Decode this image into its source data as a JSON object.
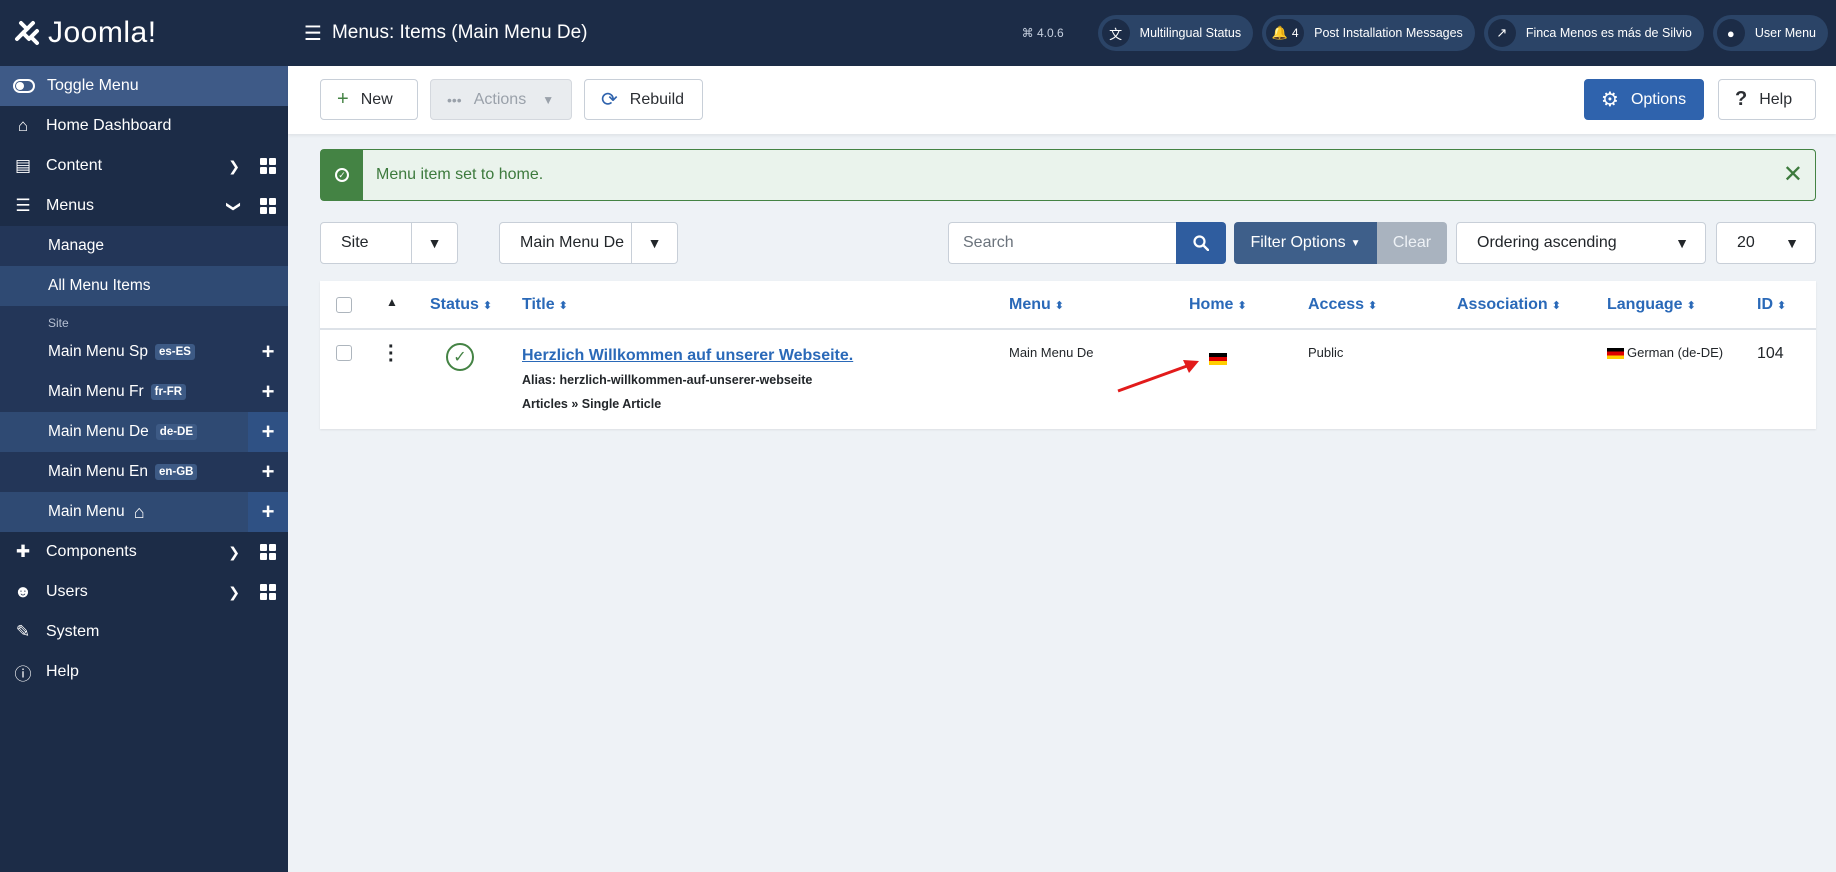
{
  "brand": {
    "name": "Joomla!"
  },
  "sidebar": {
    "toggle_label": "Toggle Menu",
    "home": "Home Dashboard",
    "content": "Content",
    "menus": "Menus",
    "menus_sub": {
      "manage": "Manage",
      "all_items": "All Menu Items",
      "site_label": "Site",
      "items": [
        {
          "label": "Main Menu Sp",
          "badge": "es-ES"
        },
        {
          "label": "Main Menu Fr",
          "badge": "fr-FR"
        },
        {
          "label": "Main Menu De",
          "badge": "de-DE"
        },
        {
          "label": "Main Menu En",
          "badge": "en-GB"
        },
        {
          "label": "Main Menu",
          "badge": ""
        }
      ]
    },
    "components": "Components",
    "users": "Users",
    "system": "System",
    "help": "Help"
  },
  "header": {
    "title": "Menus: Items (Main Menu De)",
    "version": "4.0.6",
    "multilingual": "Multilingual Status",
    "notif_count": "4",
    "post_install": "Post Installation Messages",
    "site_link": "Finca Menos es más de Silvio",
    "user_menu": "User Menu"
  },
  "toolbar": {
    "new": "New",
    "actions": "Actions",
    "rebuild": "Rebuild",
    "options": "Options",
    "help": "Help"
  },
  "alert": {
    "message": "Menu item set to home."
  },
  "filters": {
    "client": "Site",
    "menu": "Main Menu De",
    "search_placeholder": "Search",
    "filter_options": "Filter Options",
    "clear": "Clear",
    "ordering": "Ordering ascending",
    "limit": "20"
  },
  "table": {
    "columns": [
      "Status",
      "Title",
      "Menu",
      "Home",
      "Access",
      "Association",
      "Language",
      "ID"
    ],
    "rows": [
      {
        "title": "Herzlich Willkommen auf unserer Webseite.",
        "alias": "Alias: herzlich-willkommen-auf-unserer-webseite",
        "type": "Articles » Single Article",
        "menu": "Main Menu De",
        "home": "de-DE flag",
        "access": "Public",
        "association": "",
        "language": "German (de-DE)",
        "id": "104"
      }
    ]
  },
  "colors": {
    "sidebar": "#1c2c47",
    "accent": "#2f63ad",
    "success": "#448344",
    "link": "#2a69b8"
  }
}
